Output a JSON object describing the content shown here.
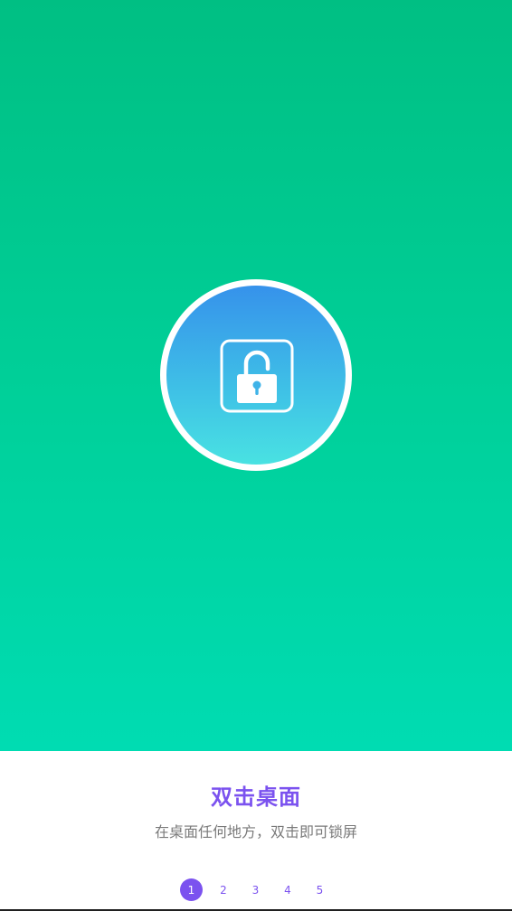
{
  "colors": {
    "hero_top": "#00bf83",
    "hero_bottom": "#00dcb2",
    "accent": "#7b52ef",
    "disc_top": "#3692eb",
    "disc_bottom": "#49e2e2",
    "subtitle_text": "#7a7a7a"
  },
  "hero": {
    "icon": "lock-icon"
  },
  "content": {
    "title": "双击桌面",
    "subtitle": "在桌面任何地方，双击即可锁屏"
  },
  "pager": {
    "pages": [
      "1",
      "2",
      "3",
      "4",
      "5"
    ],
    "active_index": 0
  }
}
